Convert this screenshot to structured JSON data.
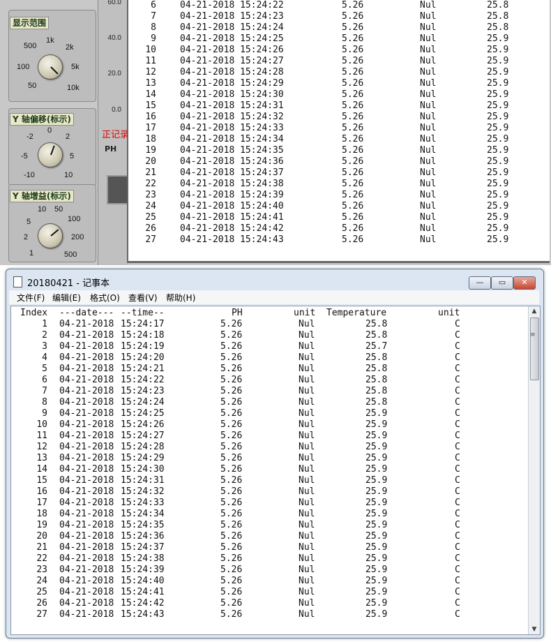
{
  "top_panel": {
    "display_range": {
      "label": "显示范围",
      "scale": [
        "1k",
        "2k",
        "500",
        "100",
        "5k",
        "50",
        "10k"
      ]
    },
    "y_offset": {
      "label": "Y 轴偏移(标示)",
      "scale": [
        "0",
        "-2",
        "2",
        "-5",
        "5",
        "-10",
        "10"
      ]
    },
    "y_gain": {
      "label": "Y 轴增益(标示)",
      "scale": [
        "10",
        "50",
        "5",
        "100",
        "2",
        "200",
        "1",
        "500"
      ]
    },
    "graph_ticks": [
      "60.0",
      "40.0",
      "20.0",
      "0.0"
    ],
    "status_text": "正记录",
    "ph_label": "PH",
    "rows": [
      [
        "6",
        "04-21-2018 15:24:22",
        "5.26",
        "Nul",
        "25.8"
      ],
      [
        "7",
        "04-21-2018 15:24:23",
        "5.26",
        "Nul",
        "25.8"
      ],
      [
        "8",
        "04-21-2018 15:24:24",
        "5.26",
        "Nul",
        "25.8"
      ],
      [
        "9",
        "04-21-2018 15:24:25",
        "5.26",
        "Nul",
        "25.9"
      ],
      [
        "10",
        "04-21-2018 15:24:26",
        "5.26",
        "Nul",
        "25.9"
      ],
      [
        "11",
        "04-21-2018 15:24:27",
        "5.26",
        "Nul",
        "25.9"
      ],
      [
        "12",
        "04-21-2018 15:24:28",
        "5.26",
        "Nul",
        "25.9"
      ],
      [
        "13",
        "04-21-2018 15:24:29",
        "5.26",
        "Nul",
        "25.9"
      ],
      [
        "14",
        "04-21-2018 15:24:30",
        "5.26",
        "Nul",
        "25.9"
      ],
      [
        "15",
        "04-21-2018 15:24:31",
        "5.26",
        "Nul",
        "25.9"
      ],
      [
        "16",
        "04-21-2018 15:24:32",
        "5.26",
        "Nul",
        "25.9"
      ],
      [
        "17",
        "04-21-2018 15:24:33",
        "5.26",
        "Nul",
        "25.9"
      ],
      [
        "18",
        "04-21-2018 15:24:34",
        "5.26",
        "Nul",
        "25.9"
      ],
      [
        "19",
        "04-21-2018 15:24:35",
        "5.26",
        "Nul",
        "25.9"
      ],
      [
        "20",
        "04-21-2018 15:24:36",
        "5.26",
        "Nul",
        "25.9"
      ],
      [
        "21",
        "04-21-2018 15:24:37",
        "5.26",
        "Nul",
        "25.9"
      ],
      [
        "22",
        "04-21-2018 15:24:38",
        "5.26",
        "Nul",
        "25.9"
      ],
      [
        "23",
        "04-21-2018 15:24:39",
        "5.26",
        "Nul",
        "25.9"
      ],
      [
        "24",
        "04-21-2018 15:24:40",
        "5.26",
        "Nul",
        "25.9"
      ],
      [
        "25",
        "04-21-2018 15:24:41",
        "5.26",
        "Nul",
        "25.9"
      ],
      [
        "26",
        "04-21-2018 15:24:42",
        "5.26",
        "Nul",
        "25.9"
      ],
      [
        "27",
        "04-21-2018 15:24:43",
        "5.26",
        "Nul",
        "25.9"
      ]
    ]
  },
  "notepad": {
    "title": "20180421 - 记事本",
    "window_buttons": {
      "minimize": "—",
      "maximize": "▭",
      "close": "✕"
    },
    "menu": [
      "文件(F)",
      "编辑(E)",
      "格式(O)",
      "查看(V)",
      "帮助(H)"
    ],
    "header": [
      "Index",
      "---date---",
      "--time--",
      "PH",
      "unit",
      "Temperature",
      "unit"
    ],
    "rows": [
      [
        "1",
        "04-21-2018",
        "15:24:17",
        "5.26",
        "Nul",
        "25.8",
        "C"
      ],
      [
        "2",
        "04-21-2018",
        "15:24:18",
        "5.26",
        "Nul",
        "25.8",
        "C"
      ],
      [
        "3",
        "04-21-2018",
        "15:24:19",
        "5.26",
        "Nul",
        "25.7",
        "C"
      ],
      [
        "4",
        "04-21-2018",
        "15:24:20",
        "5.26",
        "Nul",
        "25.8",
        "C"
      ],
      [
        "5",
        "04-21-2018",
        "15:24:21",
        "5.26",
        "Nul",
        "25.8",
        "C"
      ],
      [
        "6",
        "04-21-2018",
        "15:24:22",
        "5.26",
        "Nul",
        "25.8",
        "C"
      ],
      [
        "7",
        "04-21-2018",
        "15:24:23",
        "5.26",
        "Nul",
        "25.8",
        "C"
      ],
      [
        "8",
        "04-21-2018",
        "15:24:24",
        "5.26",
        "Nul",
        "25.8",
        "C"
      ],
      [
        "9",
        "04-21-2018",
        "15:24:25",
        "5.26",
        "Nul",
        "25.9",
        "C"
      ],
      [
        "10",
        "04-21-2018",
        "15:24:26",
        "5.26",
        "Nul",
        "25.9",
        "C"
      ],
      [
        "11",
        "04-21-2018",
        "15:24:27",
        "5.26",
        "Nul",
        "25.9",
        "C"
      ],
      [
        "12",
        "04-21-2018",
        "15:24:28",
        "5.26",
        "Nul",
        "25.9",
        "C"
      ],
      [
        "13",
        "04-21-2018",
        "15:24:29",
        "5.26",
        "Nul",
        "25.9",
        "C"
      ],
      [
        "14",
        "04-21-2018",
        "15:24:30",
        "5.26",
        "Nul",
        "25.9",
        "C"
      ],
      [
        "15",
        "04-21-2018",
        "15:24:31",
        "5.26",
        "Nul",
        "25.9",
        "C"
      ],
      [
        "16",
        "04-21-2018",
        "15:24:32",
        "5.26",
        "Nul",
        "25.9",
        "C"
      ],
      [
        "17",
        "04-21-2018",
        "15:24:33",
        "5.26",
        "Nul",
        "25.9",
        "C"
      ],
      [
        "18",
        "04-21-2018",
        "15:24:34",
        "5.26",
        "Nul",
        "25.9",
        "C"
      ],
      [
        "19",
        "04-21-2018",
        "15:24:35",
        "5.26",
        "Nul",
        "25.9",
        "C"
      ],
      [
        "20",
        "04-21-2018",
        "15:24:36",
        "5.26",
        "Nul",
        "25.9",
        "C"
      ],
      [
        "21",
        "04-21-2018",
        "15:24:37",
        "5.26",
        "Nul",
        "25.9",
        "C"
      ],
      [
        "22",
        "04-21-2018",
        "15:24:38",
        "5.26",
        "Nul",
        "25.9",
        "C"
      ],
      [
        "23",
        "04-21-2018",
        "15:24:39",
        "5.26",
        "Nul",
        "25.9",
        "C"
      ],
      [
        "24",
        "04-21-2018",
        "15:24:40",
        "5.26",
        "Nul",
        "25.9",
        "C"
      ],
      [
        "25",
        "04-21-2018",
        "15:24:41",
        "5.26",
        "Nul",
        "25.9",
        "C"
      ],
      [
        "26",
        "04-21-2018",
        "15:24:42",
        "5.26",
        "Nul",
        "25.9",
        "C"
      ],
      [
        "27",
        "04-21-2018",
        "15:24:43",
        "5.26",
        "Nul",
        "25.9",
        "C"
      ]
    ],
    "scroll_icons": {
      "up": "▲",
      "down": "▼",
      "grip": "≡"
    }
  }
}
